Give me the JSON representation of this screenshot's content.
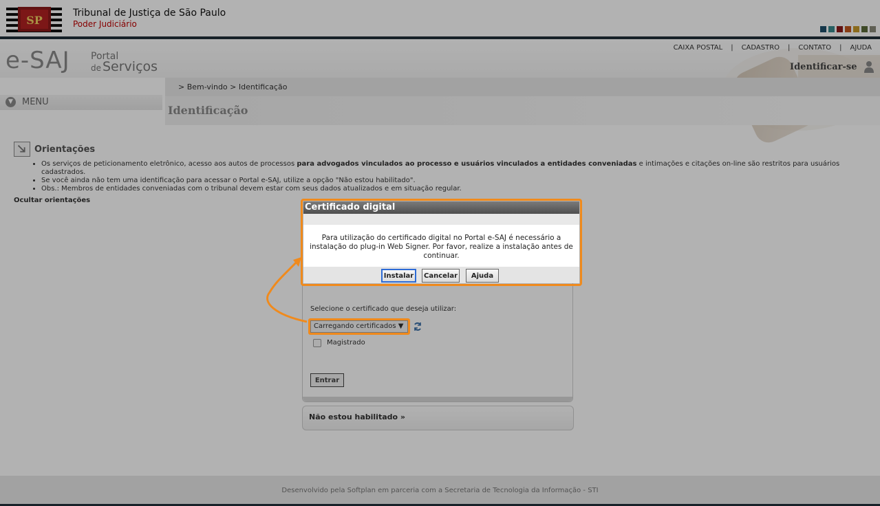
{
  "header": {
    "court_name": "Tribunal de Justiça de São Paulo",
    "court_sub": "Poder Judiciário",
    "logo_text": "SP",
    "swatch_colors": [
      "#1f4f6a",
      "#3a8a8f",
      "#8b1a1a",
      "#c2561e",
      "#c79a2a",
      "#5b6b3a",
      "#8a8a7a"
    ]
  },
  "portal": {
    "brand": "e-SAJ",
    "line1": "Portal",
    "line2_prefix": "de",
    "line2": "Serviços"
  },
  "topnav": {
    "items": [
      "CAIXA POSTAL",
      "CADASTRO",
      "CONTATO",
      "AJUDA"
    ],
    "separator": "|"
  },
  "user": {
    "identify_label": "Identificar-se"
  },
  "breadcrumb": "> Bem-vindo > Identificação",
  "menu": {
    "label": "MENU"
  },
  "page_title": "Identificação",
  "orientations": {
    "title": "Orientações",
    "item1_pre": "Os serviços de peticionamento eletrônico, acesso aos autos de processos ",
    "item1_bold": "para advogados vinculados ao processo e usuários vinculados a entidades conveniadas",
    "item1_post": " e intimações e citações on-line são restritos para usuários cadastrados.",
    "item2": "Se você ainda não tem uma identificação para acessar o Portal e-SAJ, utilize a opção \"Não estou habilitado\".",
    "item3": "Obs.: Membros de entidades conveniadas com o tribunal devem estar com seus dados atualizados e em situação regular.",
    "hide_label": "Ocultar orientações"
  },
  "login": {
    "select_label": "Selecione o certificado que deseja utilizar:",
    "select_value": "Carregando certificados",
    "magistrate_label": "Magistrado",
    "enter_label": "Entrar",
    "not_enabled_label": "Não estou habilitado",
    "not_enabled_arrow": "»"
  },
  "dialog": {
    "title": "Certificado digital",
    "message": "Para utilização do certificado digital no Portal e-SAJ é necessário a instalação do plug-in Web Signer. Por favor, realize a instalação antes de continuar.",
    "install_label": "Instalar",
    "cancel_label": "Cancelar",
    "help_label": "Ajuda"
  },
  "footer": "Desenvolvido pela Softplan em parceria com a Secretaria de Tecnologia da Informação - STI",
  "colors": {
    "highlight": "#f08a1c",
    "accent_red": "#c00000",
    "primary_button_border": "#2c6bd6"
  }
}
